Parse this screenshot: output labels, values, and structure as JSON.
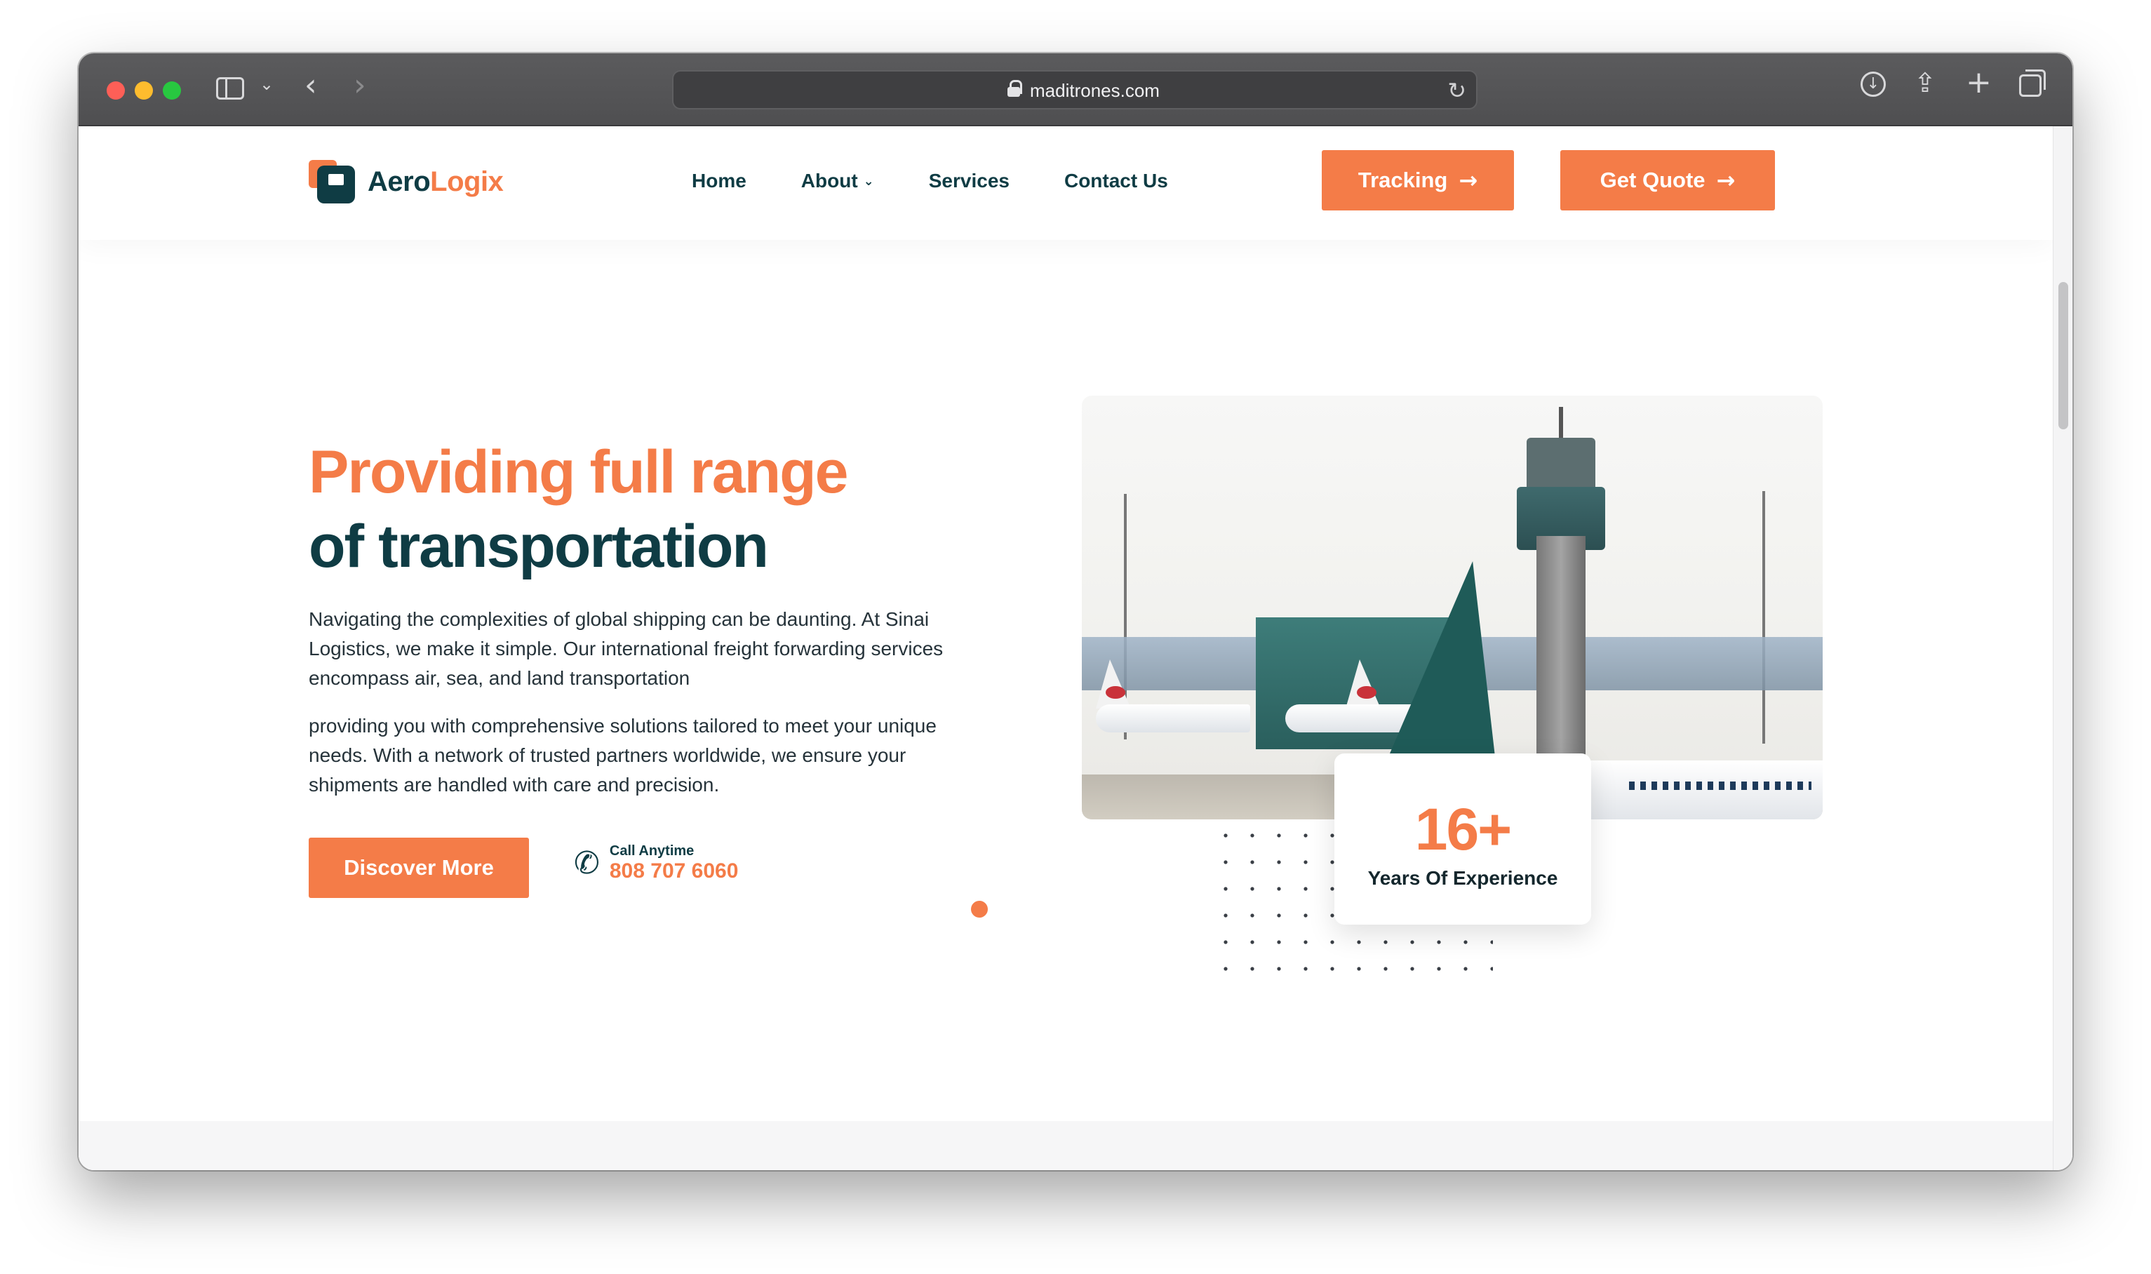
{
  "browser": {
    "url": "maditrones.com"
  },
  "brand": {
    "name_part1": "Aero",
    "name_part2": "Logix",
    "accent_color": "#f47c48",
    "primary_color": "#0f3c44"
  },
  "nav": {
    "items": [
      {
        "label": "Home"
      },
      {
        "label": "About"
      },
      {
        "label": "Services"
      },
      {
        "label": "Contact Us"
      }
    ]
  },
  "header_buttons": {
    "tracking": "Tracking",
    "quote": "Get Quote"
  },
  "hero": {
    "title_line1": "Providing full range",
    "title_line2": "of transportation",
    "paragraph1": "Navigating the complexities of global shipping can be daunting. At Sinai Logistics, we make it simple. Our international freight forwarding services encompass air, sea, and land transportation",
    "paragraph2": "providing you with comprehensive solutions tailored to meet your unique needs. With a network of trusted partners worldwide, we ensure your shipments are handled with care and precision.",
    "cta": "Discover More",
    "call_label": "Call Anytime",
    "call_number": "808 707 6060"
  },
  "experience": {
    "value": "16+",
    "label": "Years Of Experience"
  }
}
